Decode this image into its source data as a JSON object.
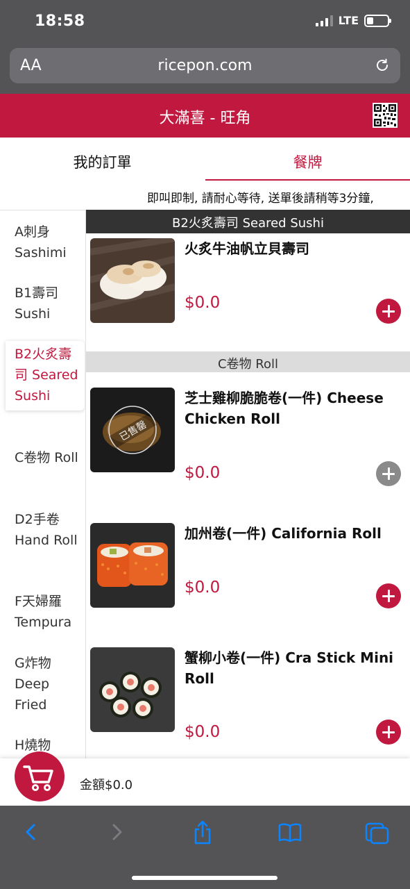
{
  "status_bar": {
    "time": "18:58",
    "network": "LTE",
    "battery_level": 0.3
  },
  "browser": {
    "aa_label": "AA",
    "url": "ricepon.com"
  },
  "header": {
    "title": "大滿喜 - 旺角"
  },
  "tabs": [
    {
      "label": "我的訂單",
      "active": false
    },
    {
      "label": "餐牌",
      "active": true
    }
  ],
  "notice": "即叫即制, 請耐心等待, 送單後請稍等3分鐘,",
  "sidebar": {
    "categories": [
      {
        "label": "A刺身 Sashimi",
        "active": false
      },
      {
        "label": "B1壽司 Sushi",
        "active": false
      },
      {
        "label": "B2火炙壽司 Seared Sushi",
        "active": true
      },
      {
        "label": "C卷物 Roll",
        "active": false
      },
      {
        "label": "D2手卷 Hand Roll",
        "active": false
      },
      {
        "label": "F天婦羅 Tempura",
        "active": false
      },
      {
        "label": "G炸物 Deep Fried",
        "active": false
      },
      {
        "label": "H燒物",
        "active": false
      }
    ]
  },
  "sections": [
    {
      "title": "B2火炙壽司 Seared Sushi",
      "items": [
        {
          "name": "火炙牛油帆立貝壽司",
          "price": "$0.0",
          "sold_out": false
        }
      ]
    },
    {
      "title": "C卷物 Roll",
      "items": [
        {
          "name": "芝士雞柳脆脆卷(一件) Cheese Chicken Roll",
          "price": "$0.0",
          "sold_out": true,
          "sold_out_label": "已售罄"
        },
        {
          "name": "加州卷(一件) California Roll",
          "price": "$0.0",
          "sold_out": false
        },
        {
          "name": "蟹柳小卷(一件) Cra Stick Mini Roll",
          "price": "$0.0",
          "sold_out": false
        }
      ]
    }
  ],
  "cart": {
    "total_label": "金額$0.0"
  },
  "colors": {
    "brand": "#c1183f",
    "chrome": "#545457",
    "ios_blue": "#0a84ff",
    "disabled": "#8a8a8a"
  },
  "icons": [
    "cart-icon",
    "qr-code-icon",
    "reload-icon",
    "back-icon",
    "forward-icon",
    "share-icon",
    "bookmarks-icon",
    "tabs-icon",
    "plus-icon"
  ]
}
